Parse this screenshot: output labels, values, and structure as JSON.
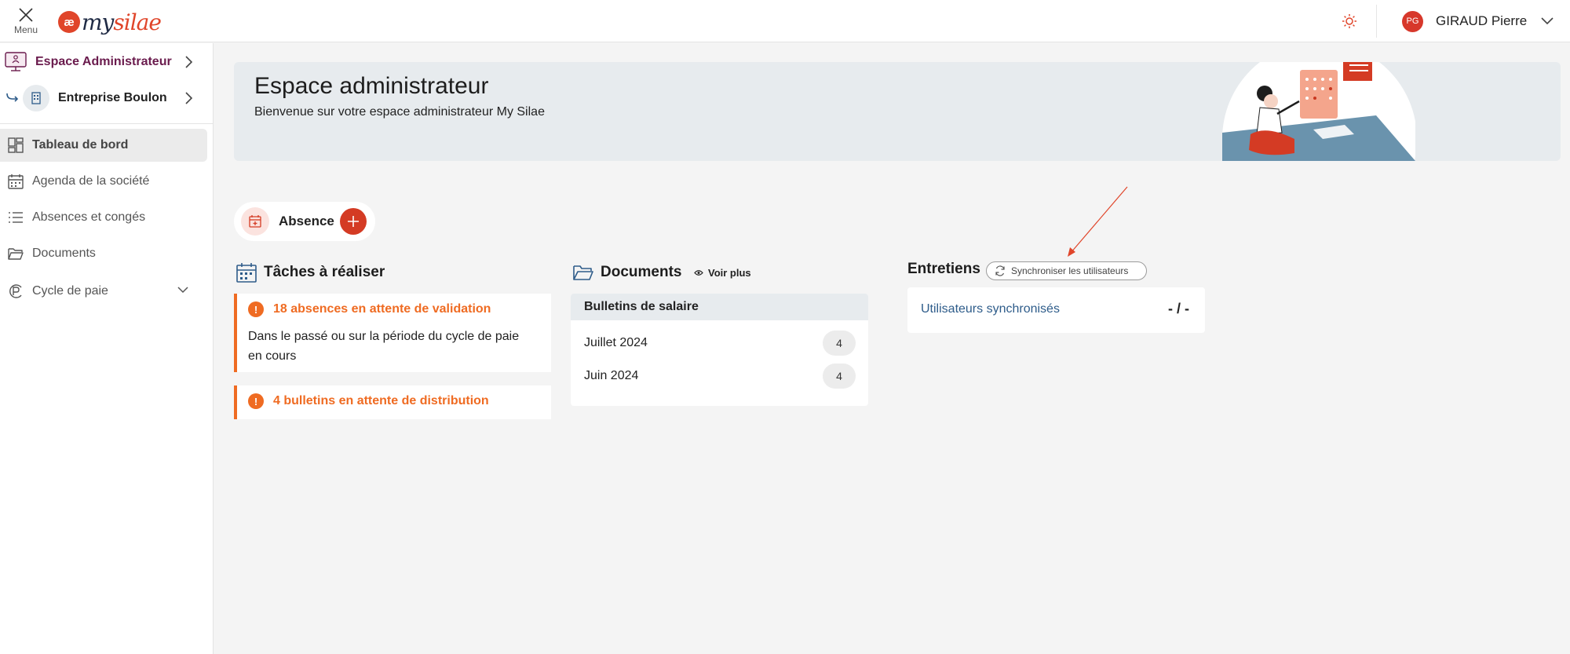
{
  "topbar": {
    "menu_label": "Menu",
    "logo_badge": "æ",
    "logo_my": "my",
    "logo_silae": "silae",
    "user_initials": "PG",
    "user_name": "GIRAUD Pierre"
  },
  "sidebar": {
    "spaces": [
      {
        "label": "Espace Administrateur",
        "color": "#6a1b4d"
      },
      {
        "label": "Entreprise Boulon",
        "color": "#222222"
      }
    ],
    "items": [
      {
        "label": "Tableau de bord",
        "icon": "dashboard-icon",
        "active": true
      },
      {
        "label": "Agenda de la société",
        "icon": "calendar-icon"
      },
      {
        "label": "Absences et congés",
        "icon": "list-icon"
      },
      {
        "label": "Documents",
        "icon": "folder-icon"
      },
      {
        "label": "Cycle de paie",
        "icon": "payroll-icon",
        "expandable": true
      }
    ]
  },
  "hero": {
    "title": "Espace administrateur",
    "subtitle": "Bienvenue sur votre espace administrateur My Silae"
  },
  "quick_action": {
    "label": "Absence"
  },
  "tasks": {
    "title": "Tâches à réaliser",
    "items": [
      {
        "title": "18 absences en attente de validation",
        "description": "Dans le passé ou sur la période du cycle de paie en cours"
      },
      {
        "title": "4 bulletins en attente de distribution"
      }
    ]
  },
  "documents": {
    "title": "Documents",
    "more_label": "Voir plus",
    "group_title": "Bulletins de salaire",
    "rows": [
      {
        "label": "Juillet 2024",
        "count": "4"
      },
      {
        "label": "Juin 2024",
        "count": "4"
      }
    ]
  },
  "interviews": {
    "title": "Entretiens",
    "sync_label": "Synchroniser les utilisateurs",
    "row_label": "Utilisateurs synchronisés",
    "row_value": "- / -"
  },
  "colors": {
    "accent": "#d43b24",
    "warning": "#ef6b22",
    "link": "#2e5c8a"
  }
}
